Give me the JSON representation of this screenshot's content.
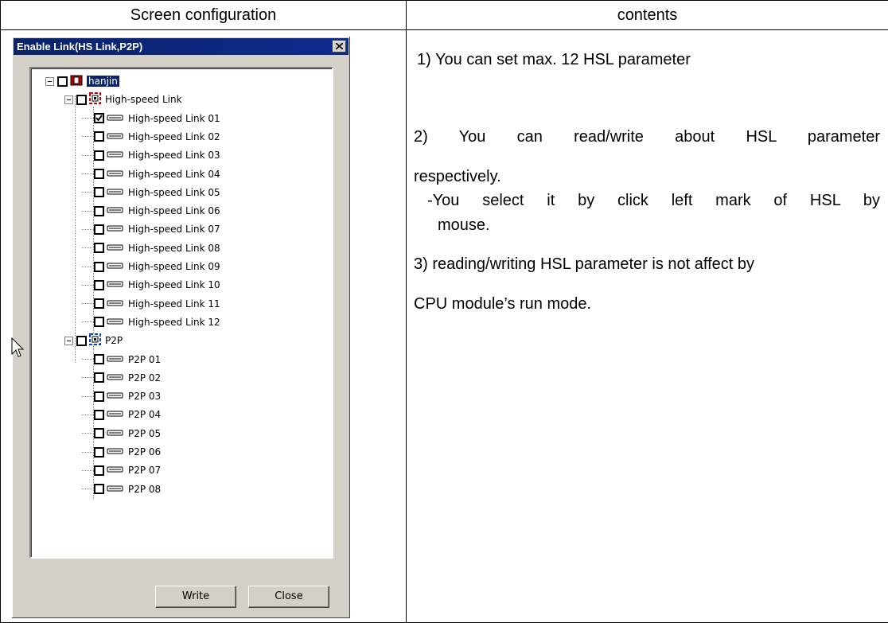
{
  "header": {
    "col1": "Screen configuration",
    "col2": "contents"
  },
  "dialog": {
    "title": "Enable Link(HS Link,P2P)",
    "root_label": "hanjin",
    "hsl_group_label": "High-speed Link",
    "hsl_items": [
      {
        "label": "High-speed Link 01",
        "checked": true
      },
      {
        "label": "High-speed Link 02",
        "checked": false
      },
      {
        "label": "High-speed Link 03",
        "checked": false
      },
      {
        "label": "High-speed Link 04",
        "checked": false
      },
      {
        "label": "High-speed Link 05",
        "checked": false
      },
      {
        "label": "High-speed Link 06",
        "checked": false
      },
      {
        "label": "High-speed Link 07",
        "checked": false
      },
      {
        "label": "High-speed Link 08",
        "checked": false
      },
      {
        "label": "High-speed Link 09",
        "checked": false
      },
      {
        "label": "High-speed Link 10",
        "checked": false
      },
      {
        "label": "High-speed Link 11",
        "checked": false
      },
      {
        "label": "High-speed Link 12",
        "checked": false
      }
    ],
    "p2p_group_label": "P2P",
    "p2p_items": [
      {
        "label": "P2P 01",
        "checked": false
      },
      {
        "label": "P2P 02",
        "checked": false
      },
      {
        "label": "P2P 03",
        "checked": false
      },
      {
        "label": "P2P 04",
        "checked": false
      },
      {
        "label": "P2P 05",
        "checked": false
      },
      {
        "label": "P2P 06",
        "checked": false
      },
      {
        "label": "P2P 07",
        "checked": false
      },
      {
        "label": "P2P 08",
        "checked": false
      }
    ],
    "write_label": "Write",
    "close_label": "Close"
  },
  "contents": {
    "line1": "1) You can set max. 12 HSL parameter",
    "line2a": "2)  You  can  read/write  about  HSL  parameter",
    "line2b": "respectively.",
    "line2c": "-You  select  it  by  click  left  mark  of  HSL  by",
    "line2d": "mouse.",
    "line3a": "3) reading/writing HSL parameter is not affect by",
    "line3b": "CPU module’s run mode."
  }
}
